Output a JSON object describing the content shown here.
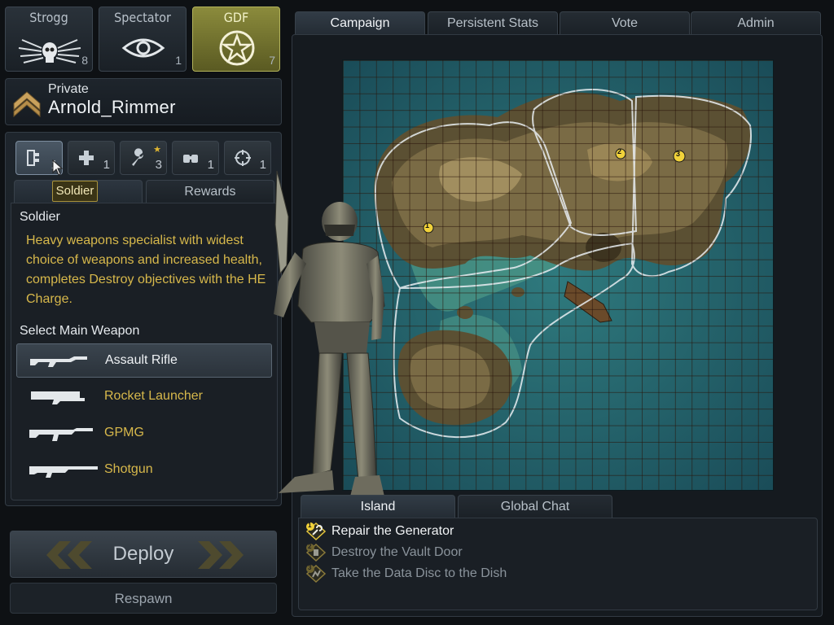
{
  "teams": [
    {
      "name": "Strogg",
      "count": "8",
      "icon": "strogg-skull-icon"
    },
    {
      "name": "Spectator",
      "count": "1",
      "icon": "eye-icon"
    },
    {
      "name": "GDF",
      "count": "7",
      "icon": "gdf-star-icon"
    }
  ],
  "player": {
    "rank": "Private",
    "name": "Arnold_Rimmer"
  },
  "classes": [
    {
      "icon": "soldier-class-icon",
      "count": "1"
    },
    {
      "icon": "medic-cross-icon",
      "count": "1"
    },
    {
      "icon": "engineer-wrench-icon",
      "count": "3"
    },
    {
      "icon": "fieldops-binoculars-icon",
      "count": "1"
    },
    {
      "icon": "covertops-crosshair-icon",
      "count": "1"
    }
  ],
  "tooltip": "Soldier",
  "subtabs": {
    "class": "",
    "rewards": "Rewards"
  },
  "class_info": {
    "title": "Soldier",
    "description": "Heavy weapons specialist with widest choice of weapons and increased health, completes Destroy objectives with the HE Charge.",
    "weapon_heading": "Select Main Weapon",
    "weapons": [
      "Assault Rifle",
      "Rocket Launcher",
      "GPMG",
      "Shotgun"
    ]
  },
  "deploy": {
    "label": "Deploy",
    "respawn": "Respawn"
  },
  "main_tabs": [
    "Campaign",
    "Persistent Stats",
    "Vote",
    "Admin"
  ],
  "map_markers": [
    "1",
    "2",
    "3"
  ],
  "bottom_tabs": [
    "Island",
    "Global Chat"
  ],
  "objectives": [
    {
      "num": "1",
      "label": "Repair the Generator",
      "state": "active"
    },
    {
      "num": "2",
      "label": "Destroy the Vault Door",
      "state": "inactive"
    },
    {
      "num": "3",
      "label": "Take the Data Disc to the Dish",
      "state": "inactive"
    }
  ],
  "colors": {
    "accent_gold": "#d7b84b",
    "gdf_active": "#8b8b3c"
  }
}
